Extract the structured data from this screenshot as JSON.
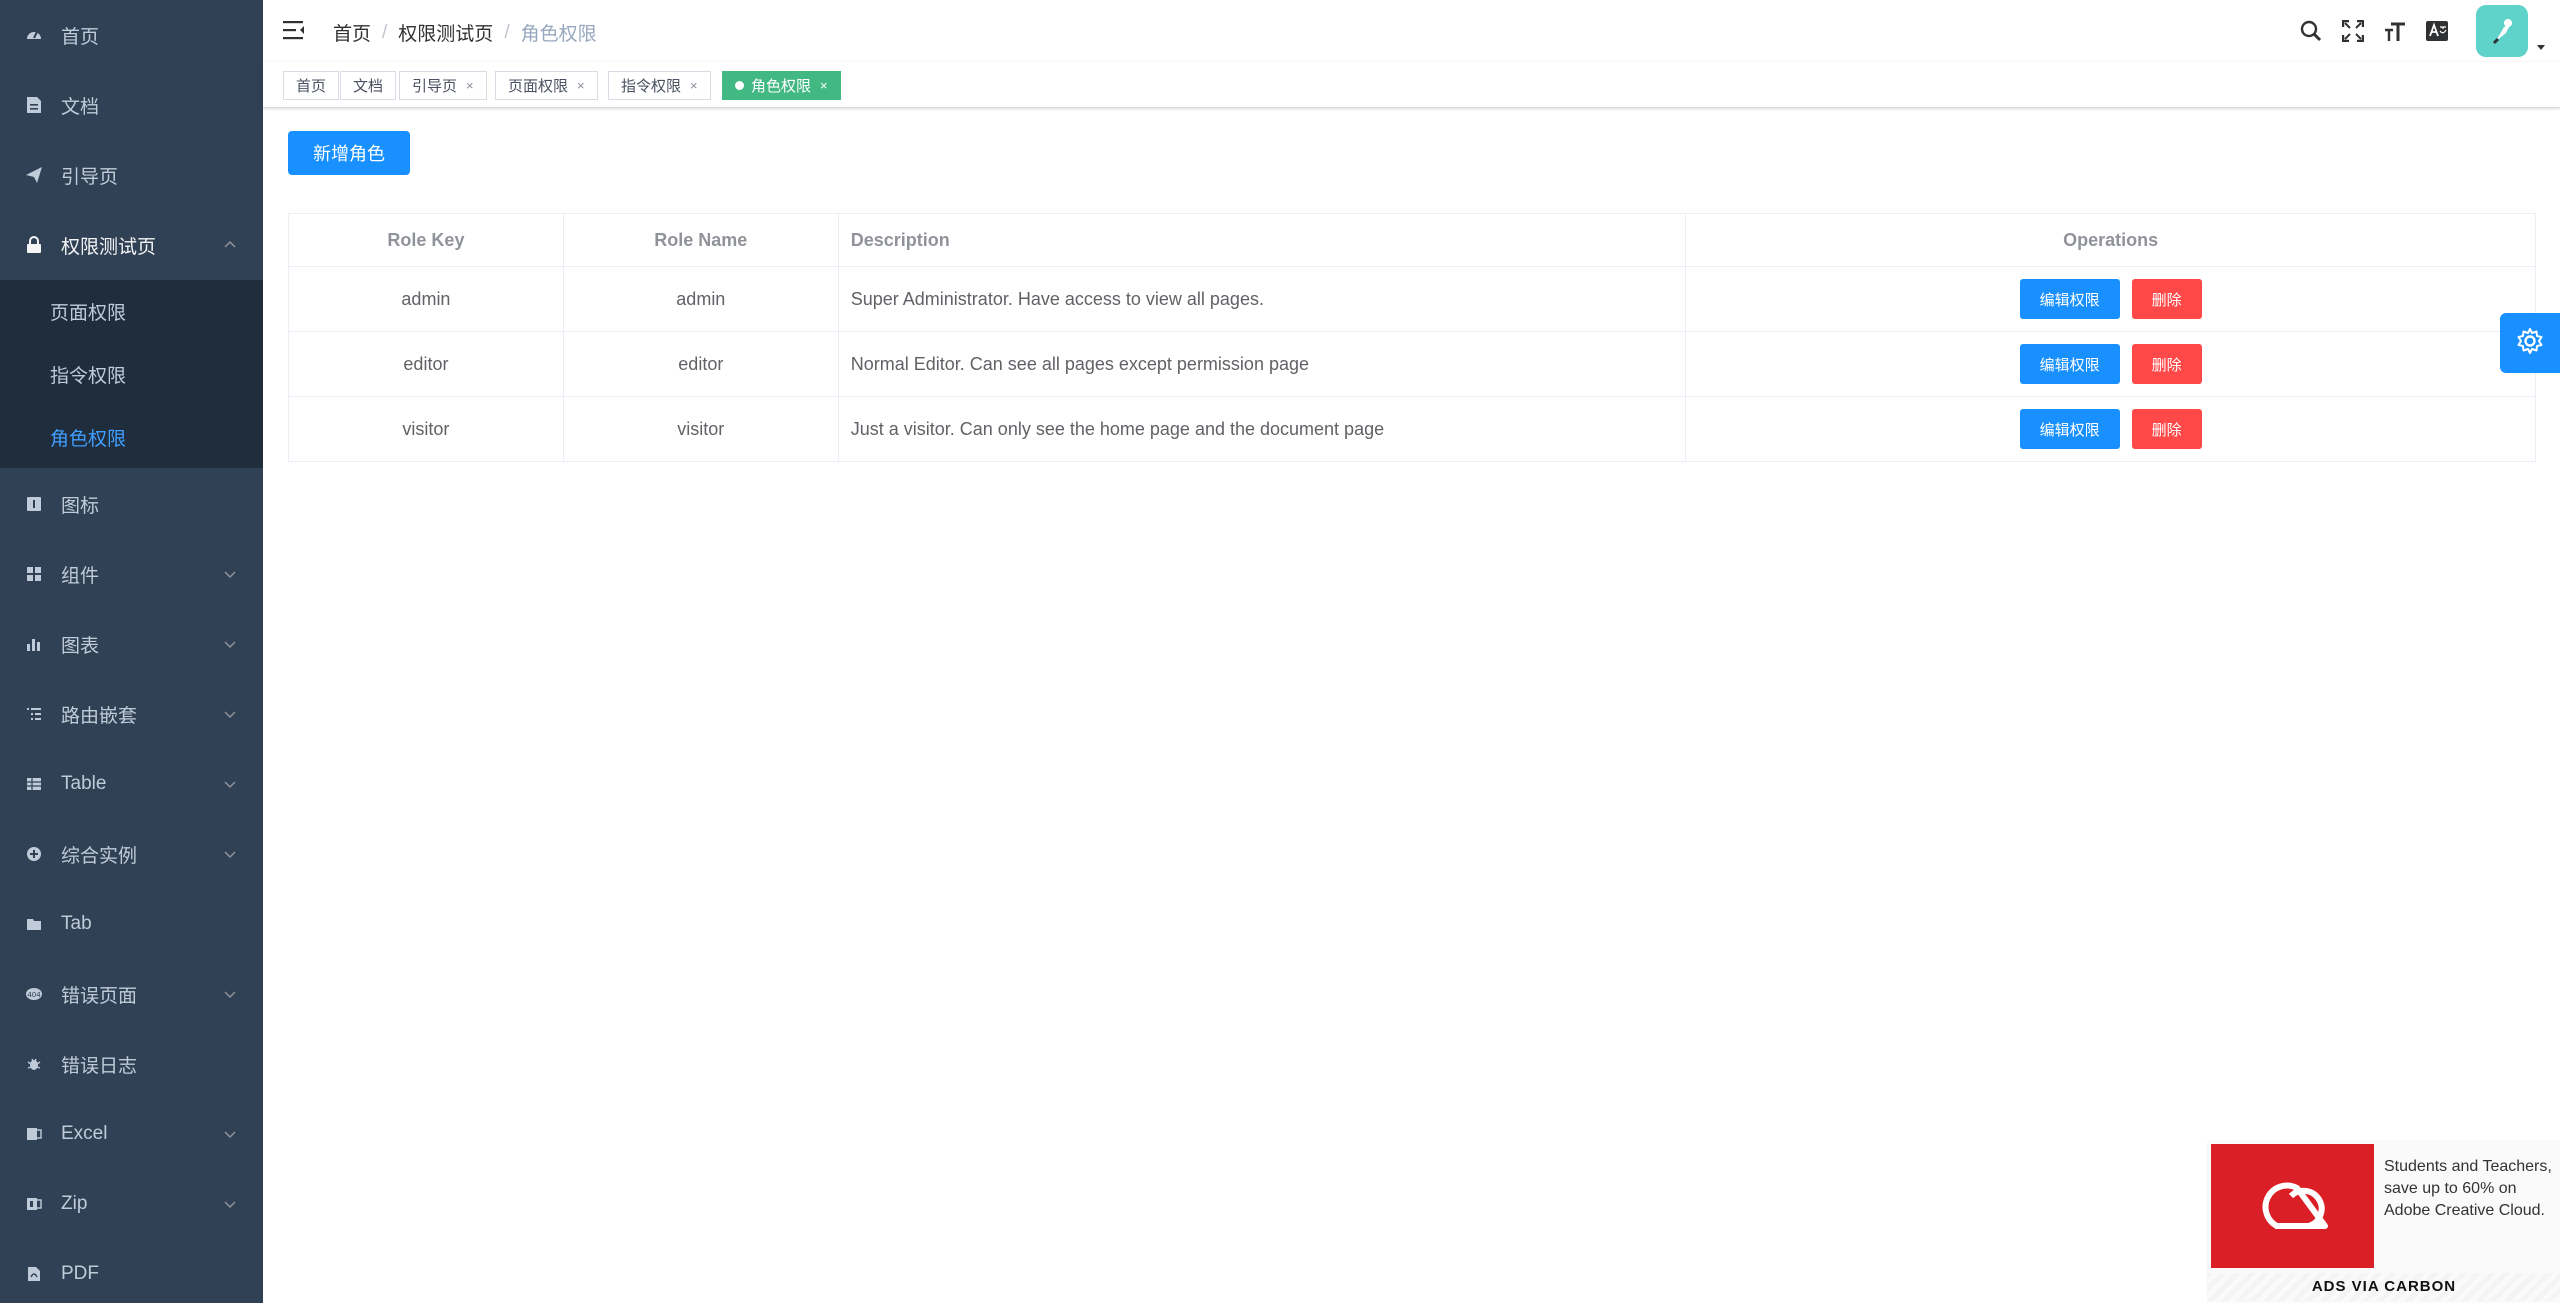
{
  "colors": {
    "sidebar_bg": "#304156",
    "submenu_bg": "#1f2d3d",
    "accent": "#409eff",
    "primary": "#1890ff",
    "danger": "#ff4949",
    "tag_active": "#42b983"
  },
  "sidebar": {
    "items": [
      {
        "label": "首页",
        "icon": "dashboard-icon"
      },
      {
        "label": "文档",
        "icon": "document-icon"
      },
      {
        "label": "引导页",
        "icon": "guide-icon"
      },
      {
        "label": "权限测试页",
        "icon": "lock-icon",
        "expanded": true,
        "children": [
          {
            "label": "页面权限"
          },
          {
            "label": "指令权限"
          },
          {
            "label": "角色权限",
            "active": true
          }
        ]
      },
      {
        "label": "图标",
        "icon": "icon-icon"
      },
      {
        "label": "组件",
        "icon": "component-icon"
      },
      {
        "label": "图表",
        "icon": "chart-icon"
      },
      {
        "label": "路由嵌套",
        "icon": "nested-icon"
      },
      {
        "label": "Table",
        "icon": "table-icon"
      },
      {
        "label": "综合实例",
        "icon": "example-icon"
      },
      {
        "label": "Tab",
        "icon": "tab-icon"
      },
      {
        "label": "错误页面",
        "icon": "error-page-icon"
      },
      {
        "label": "错误日志",
        "icon": "bug-icon"
      },
      {
        "label": "Excel",
        "icon": "excel-icon"
      },
      {
        "label": "Zip",
        "icon": "zip-icon"
      },
      {
        "label": "PDF",
        "icon": "pdf-icon"
      }
    ]
  },
  "navbar": {
    "breadcrumb": [
      "首页",
      "权限测试页",
      "角色权限"
    ],
    "icons": [
      "search-icon",
      "fullscreen-icon",
      "size-icon",
      "language-icon"
    ]
  },
  "tags": [
    {
      "label": "首页",
      "closable": false
    },
    {
      "label": "文档",
      "closable": false
    },
    {
      "label": "引导页",
      "closable": true
    },
    {
      "label": "页面权限",
      "closable": true
    },
    {
      "label": "指令权限",
      "closable": true
    },
    {
      "label": "角色权限",
      "closable": true,
      "active": true
    }
  ],
  "tag_close_glyph": "×",
  "main": {
    "add_button": "新增角色",
    "table": {
      "headers": [
        "Role Key",
        "Role Name",
        "Description",
        "Operations"
      ],
      "rows": [
        {
          "key": "admin",
          "name": "admin",
          "description": "Super Administrator. Have access to view all pages."
        },
        {
          "key": "editor",
          "name": "editor",
          "description": "Normal Editor. Can see all pages except permission page"
        },
        {
          "key": "visitor",
          "name": "visitor",
          "description": "Just a visitor. Can only see the home page and the document page"
        }
      ],
      "edit_label": "编辑权限",
      "delete_label": "删除"
    }
  },
  "carbon": {
    "text": "Students and Teachers, save up to 60% on Adobe Creative Cloud.",
    "poweredby": "ADS VIA CARBON"
  }
}
